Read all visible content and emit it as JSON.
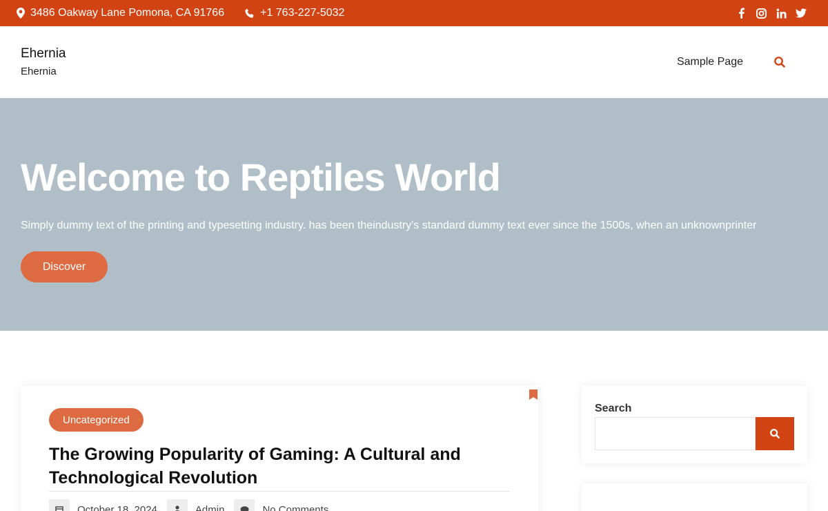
{
  "topbar": {
    "address": "3486 Oakway Lane Pomona, CA 91766",
    "phone": "+1 763-227-5032",
    "social": [
      "facebook-icon",
      "instagram-icon",
      "linkedin-icon",
      "twitter-icon"
    ],
    "background": "#d14313"
  },
  "header": {
    "site_title": "Ehernia",
    "tagline": "Ehernia",
    "nav": [
      "Sample Page"
    ]
  },
  "hero": {
    "title": "Welcome to Reptiles World",
    "text": "Simply dummy text of the printing and typesetting industry. has been theindustry's standard dummy text ever since the 1500s, when an unknownprinter",
    "button": "Discover",
    "background": "#afbec7",
    "accent": "#dd6a41"
  },
  "post": {
    "category": "Uncategorized",
    "title": "The Growing Popularity of Gaming: A Cultural and Technological Revolution",
    "date": "October 18, 2024",
    "author": "Admin",
    "comments": "No Comments"
  },
  "sidebar": {
    "search_label": "Search",
    "search_value": ""
  }
}
